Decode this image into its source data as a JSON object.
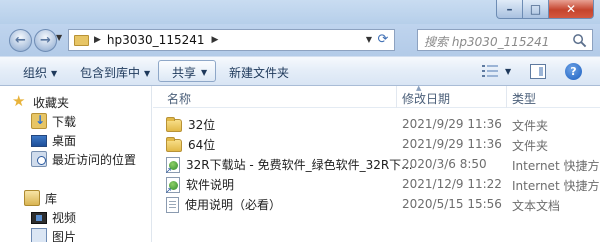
{
  "window": {
    "title": "",
    "controls": {
      "minimize": "–",
      "maximize": "□",
      "close": "✕"
    }
  },
  "navigation": {
    "back_icon": "arrow-left-icon",
    "forward_icon": "arrow-right-icon"
  },
  "address_bar": {
    "path": "hp3030_115241"
  },
  "search": {
    "placeholder": "搜索 hp3030_115241"
  },
  "command_bar": {
    "organize": "组织",
    "include_in_library": "包含到库中",
    "share": "共享",
    "new_folder": "新建文件夹"
  },
  "sidebar": {
    "items": [
      {
        "label": "收藏夹",
        "icon": "star-icon",
        "level": 0
      },
      {
        "label": "下载",
        "icon": "downloads-folder-icon",
        "level": 1
      },
      {
        "label": "桌面",
        "icon": "desktop-icon",
        "level": 1
      },
      {
        "label": "最近访问的位置",
        "icon": "recent-places-icon",
        "level": 1
      },
      {
        "label": "库",
        "icon": "library-icon",
        "level": 0
      },
      {
        "label": "视频",
        "icon": "video-library-icon",
        "level": 1
      },
      {
        "label": "图片",
        "icon": "pictures-library-icon",
        "level": 1
      }
    ]
  },
  "file_list": {
    "columns": {
      "name": "名称",
      "modified": "修改日期",
      "type": "类型"
    },
    "rows": [
      {
        "name": "32位",
        "modified": "2021/9/29 11:36",
        "type": "文件夹",
        "icon": "folder-icon"
      },
      {
        "name": "64位",
        "modified": "2021/9/29 11:36",
        "type": "文件夹",
        "icon": "folder-icon"
      },
      {
        "name": "32R下载站 - 免费软件_绿色软件_32R下...",
        "modified": "2020/3/6 8:50",
        "type": "Internet 快捷方式",
        "icon": "internet-shortcut-icon"
      },
      {
        "name": "软件说明",
        "modified": "2021/12/9 11:22",
        "type": "Internet 快捷方式",
        "icon": "internet-shortcut-icon"
      },
      {
        "name": "使用说明（必看）",
        "modified": "2020/5/15 15:56",
        "type": "文本文档",
        "icon": "text-document-icon"
      }
    ]
  }
}
